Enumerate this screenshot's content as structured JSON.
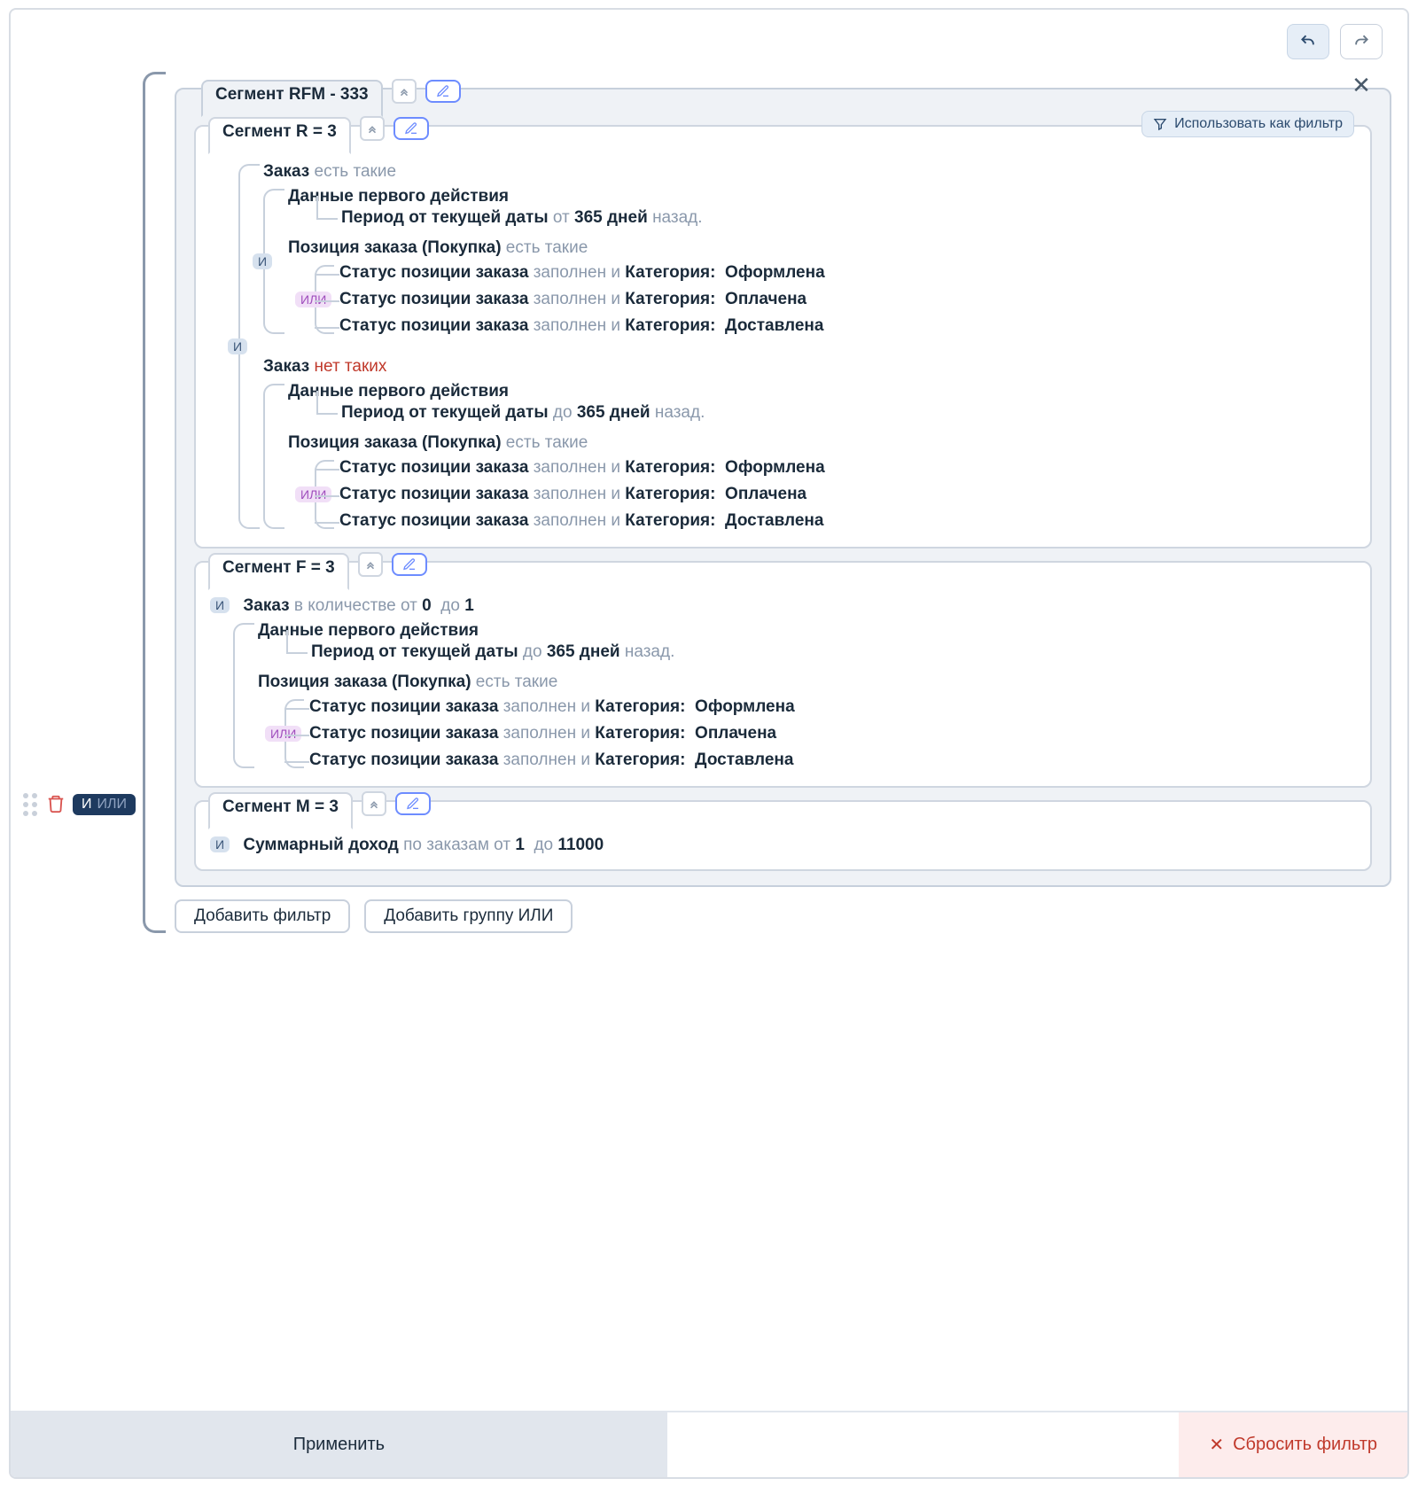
{
  "toolbar": {
    "undo": "undo",
    "redo": "redo"
  },
  "left": {
    "and": "И",
    "or": "ИЛИ"
  },
  "rfm": {
    "title": "Сегмент RFM - 333",
    "filterBtn": "Использовать как фильтр",
    "r": {
      "title": "Сегмент R = 3",
      "zakaz1": {
        "label": "Заказ",
        "cond": "есть такие"
      },
      "zakaz2": {
        "label": "Заказ",
        "cond": "нет таких"
      },
      "dpd": "Данные первого действия",
      "period_from_b": "Период от текущей даты",
      "period_from_mid": "от",
      "period_to_mid": "до",
      "days_b": "365 дней",
      "period_suffix": "назад.",
      "position_b": "Позиция заказа (Покупка)",
      "position_cond": "есть такие",
      "status_b": "Статус позиции заказа",
      "status_mid": "заполнен и",
      "cat_b": "Категория:",
      "cats": [
        "Оформлена",
        "Оплачена",
        "Доставлена"
      ]
    },
    "f": {
      "title": "Сегмент F = 3",
      "zakaz_b": "Заказ",
      "zakaz_cond_pre": "в количестве от",
      "zakaz_v1": "0",
      "zakaz_mid": "до",
      "zakaz_v2": "1",
      "dpd": "Данные первого действия",
      "period_b": "Период от текущей даты",
      "period_mid": "до",
      "days_b": "365 дней",
      "period_suffix": "назад.",
      "position_b": "Позиция заказа (Покупка)",
      "position_cond": "есть такие",
      "status_b": "Статус позиции заказа",
      "status_mid": "заполнен и",
      "cat_b": "Категория:",
      "cats": [
        "Оформлена",
        "Оплачена",
        "Доставлена"
      ]
    },
    "m": {
      "title": "Сегмент M = 3",
      "sum_b": "Суммарный доход",
      "sum_pre": "по заказам от",
      "sum_v1": "1",
      "sum_mid": "до",
      "sum_v2": "11000"
    }
  },
  "badges": {
    "and": "И",
    "or": "ИЛИ"
  },
  "actions": {
    "addFilter": "Добавить фильтр",
    "addOrGroup": "Добавить группу ИЛИ",
    "apply": "Применить",
    "reset": "Сбросить фильтр"
  }
}
